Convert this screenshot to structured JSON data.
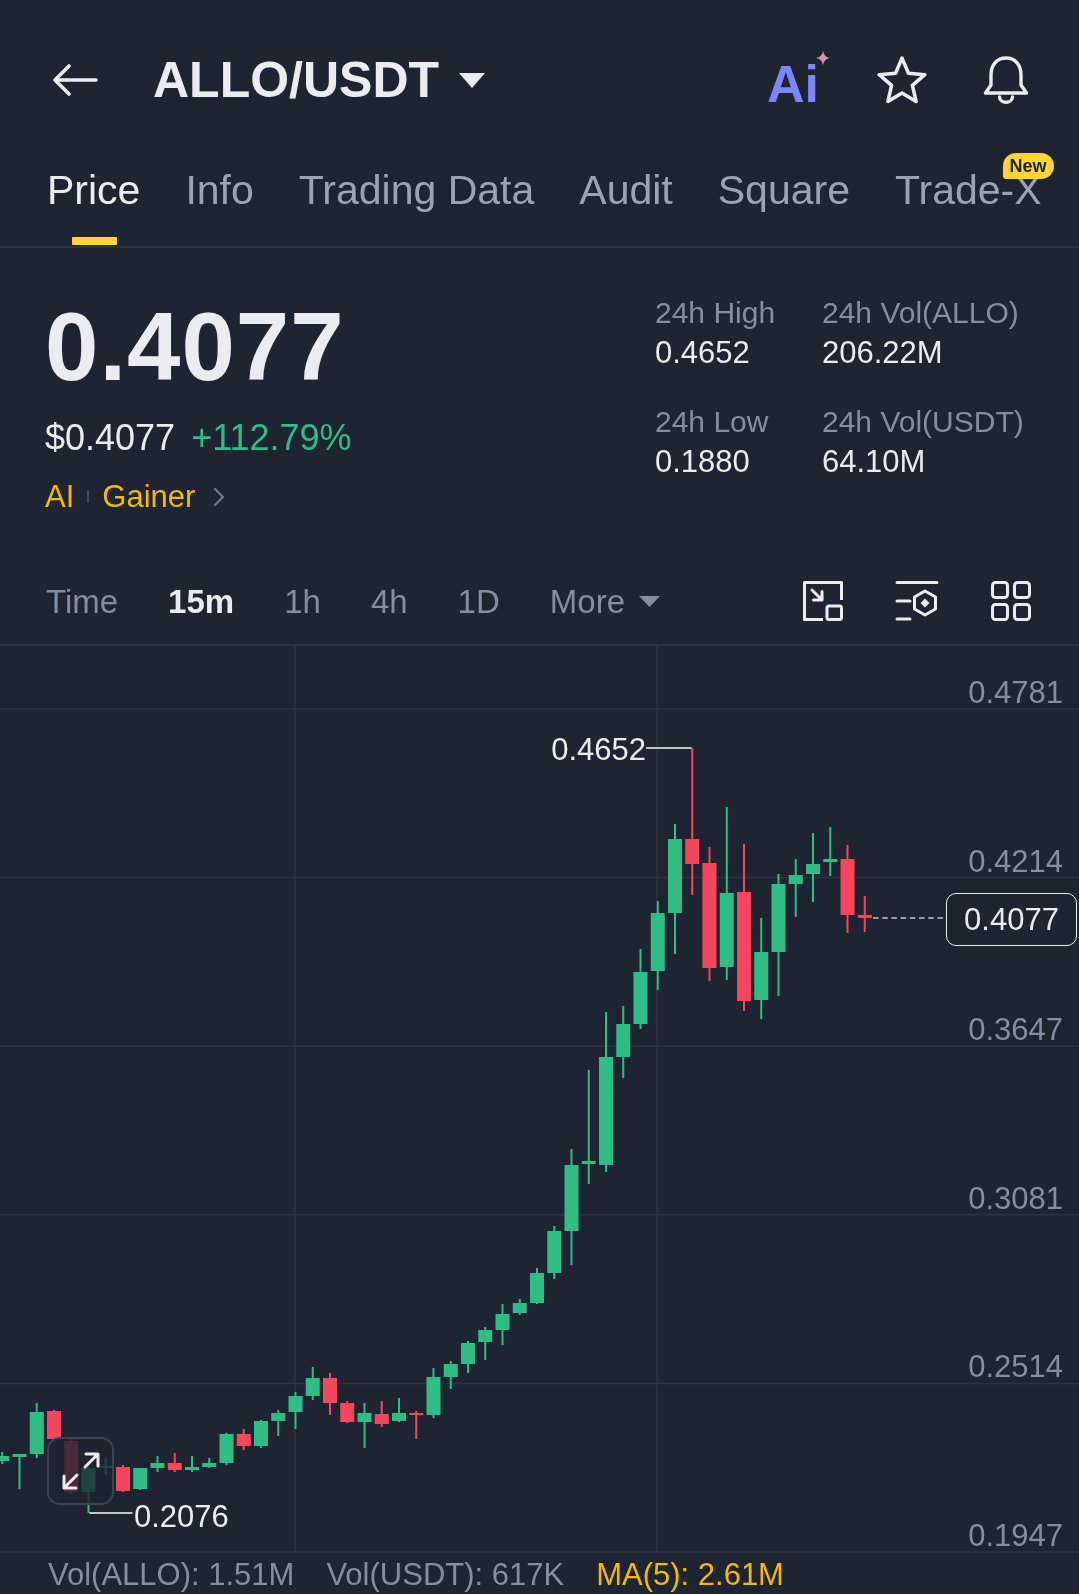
{
  "header": {
    "title": "ALLO/USDT",
    "ai_label": "Ai"
  },
  "tabs": [
    {
      "label": "Price",
      "selected": true
    },
    {
      "label": "Info",
      "selected": false
    },
    {
      "label": "Trading Data",
      "selected": false
    },
    {
      "label": "Audit",
      "selected": false
    },
    {
      "label": "Square",
      "selected": false
    },
    {
      "label": "Trade-X",
      "selected": false,
      "badge": "New"
    }
  ],
  "ticker": {
    "last_price": "0.4077",
    "usd_price": "$0.4077",
    "change": "+112.79%",
    "tags": [
      "AI",
      "Gainer"
    ]
  },
  "stats": [
    {
      "label": "24h High",
      "value": "0.4652"
    },
    {
      "label": "24h Vol(ALLO)",
      "value": "206.22M"
    },
    {
      "label": "24h Low",
      "value": "0.1880"
    },
    {
      "label": "24h Vol(USDT)",
      "value": "64.10M"
    }
  ],
  "intervals": [
    {
      "label": "Time",
      "selected": false,
      "kind": "interval"
    },
    {
      "label": "15m",
      "selected": true,
      "kind": "interval"
    },
    {
      "label": "1h",
      "selected": false,
      "kind": "interval"
    },
    {
      "label": "4h",
      "selected": false,
      "kind": "interval"
    },
    {
      "label": "1D",
      "selected": false,
      "kind": "interval"
    },
    {
      "label": "More",
      "selected": false,
      "kind": "menu"
    }
  ],
  "chart": {
    "y_axis_labels": [
      "0.4781",
      "0.4214",
      "0.3647",
      "0.3081",
      "0.2514",
      "0.1947"
    ],
    "high_label": "0.4652",
    "low_label": "0.2076",
    "current_price": "0.4077"
  },
  "footer": [
    {
      "label": "Vol(ALLO): 1.51M",
      "kind": "volume"
    },
    {
      "label": "Vol(USDT): 617K",
      "kind": "volume"
    },
    {
      "label": "MA(5): 2.61M",
      "kind": "average"
    }
  ]
}
